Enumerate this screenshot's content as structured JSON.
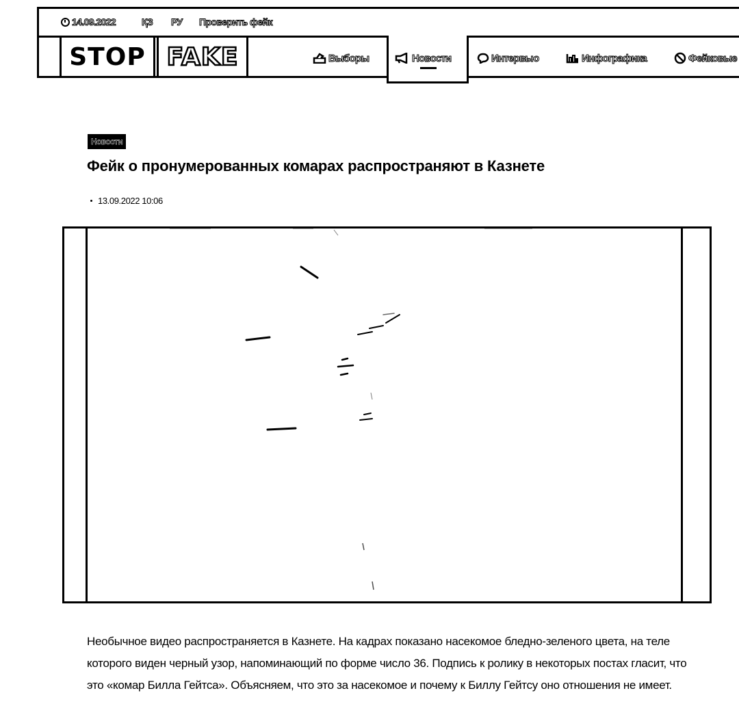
{
  "topbar": {
    "date": "14.09.2022",
    "lang_kz": "ҚЗ",
    "lang_ru": "РУ",
    "check_fake": "Проверить фейк"
  },
  "logo": {
    "stop": "STOP",
    "fake": "FAKE"
  },
  "nav": {
    "items": [
      {
        "label": "Выборы",
        "icon": "ballot-icon"
      },
      {
        "label": "Новости",
        "icon": "megaphone-icon",
        "active": true
      },
      {
        "label": "Интервью",
        "icon": "chat-bubble-icon"
      },
      {
        "label": "Инфографика",
        "icon": "chart-icon"
      },
      {
        "label": "Фейковые",
        "icon": "no-sign-icon"
      }
    ]
  },
  "article": {
    "tag": "Новости",
    "title": "Фейк о пронумерованных комарах распространяют в Казнете",
    "datetime": "13.09.2022 10:06",
    "body": "Необычное видео распространяется в Казнете. На кадрах показано насекомое бледно-зеленого цвета, на теле которого виден черный узор, напоминающий по форме число 36. Подпись к ролику в некоторых постах гласит, что это «комар Билла Гейтса». Объясняем, что это за насекомое и почему к Биллу Гейтсу оно отношения не имеет."
  }
}
